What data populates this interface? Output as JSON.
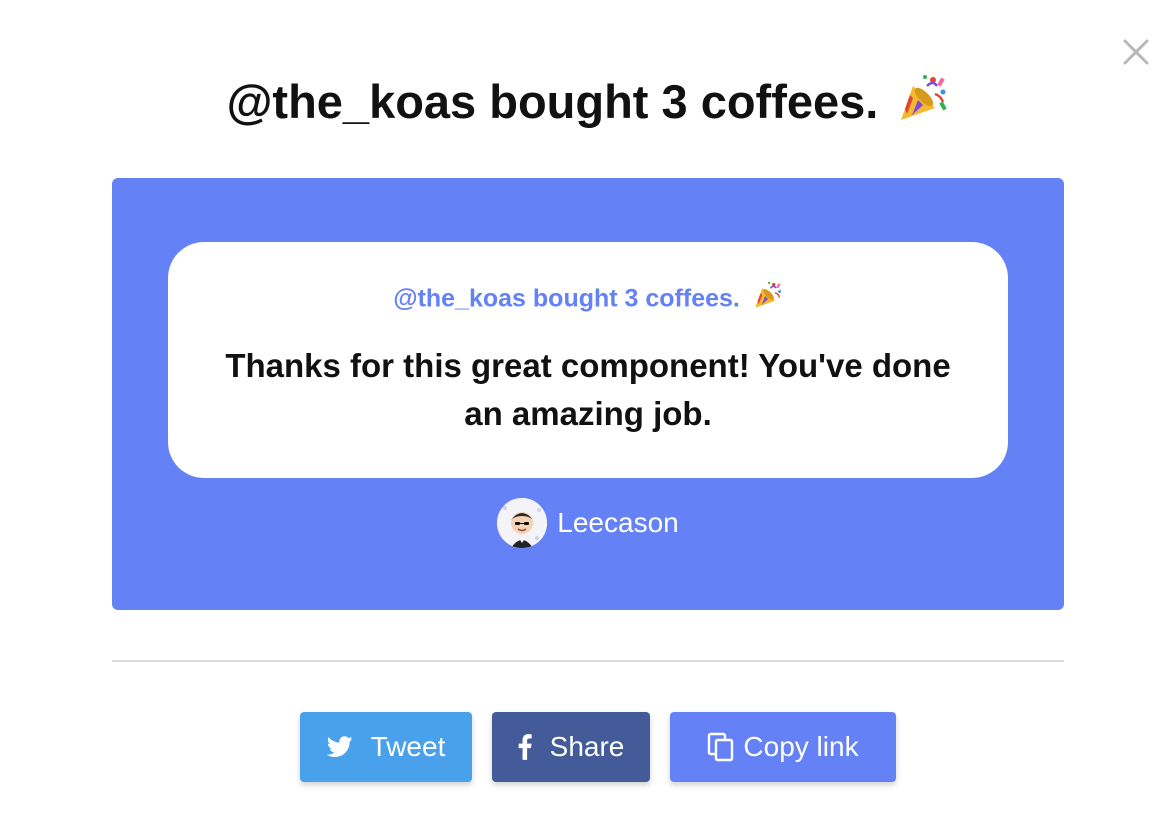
{
  "headline": {
    "text": "@the_koas bought 3 coffees.",
    "emoji_icon": "party-popper-icon"
  },
  "close": {
    "icon": "close-icon"
  },
  "card": {
    "title": "@the_koas bought 3 coffees.",
    "emoji_icon": "party-popper-icon",
    "message": "Thanks for this great component! You've done an amazing job.",
    "author_name": "Leecason",
    "avatar_icon": "avatar"
  },
  "share": {
    "tweet_label": "Tweet",
    "share_label": "Share",
    "copy_label": "Copy link"
  },
  "colors": {
    "panel": "#6482f6",
    "tweet": "#4aa1eb",
    "facebook": "#435b99",
    "copy": "#6482f6"
  }
}
